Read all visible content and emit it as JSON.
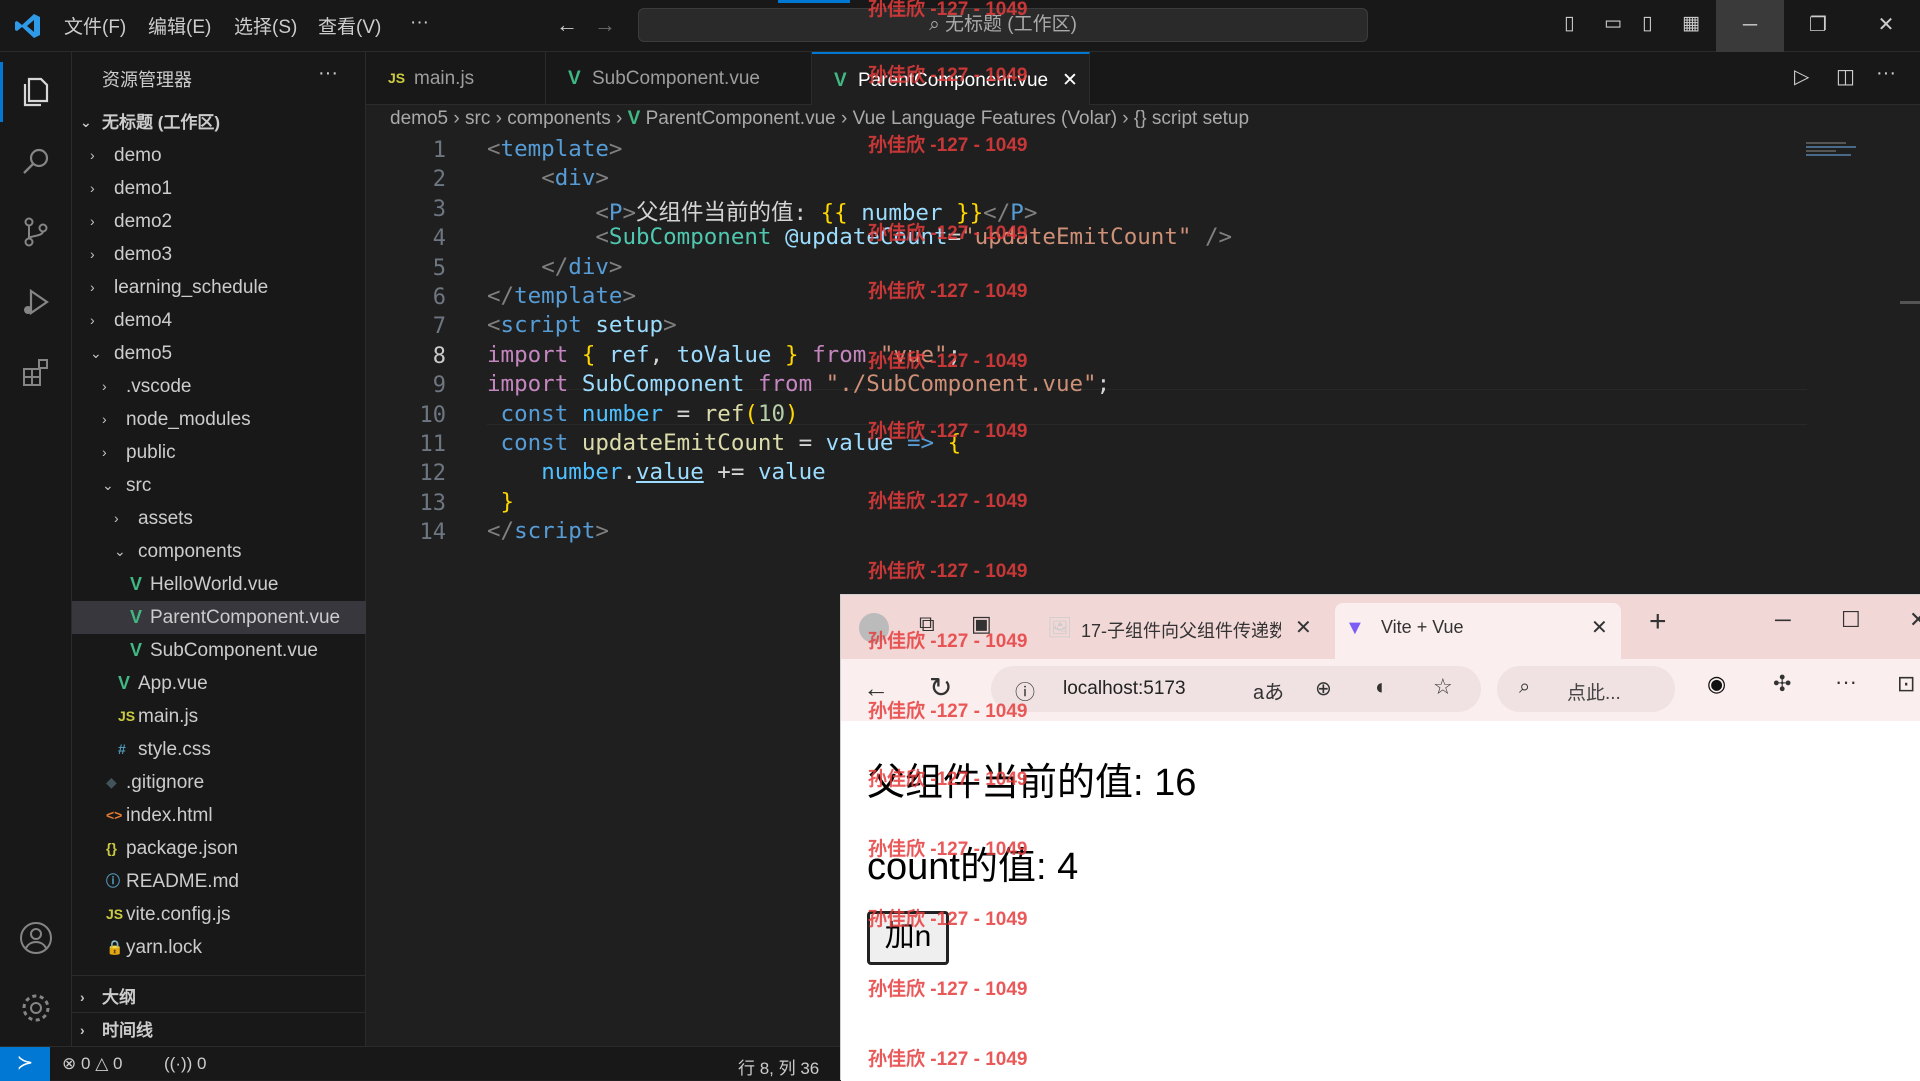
{
  "titlebar": {
    "menu": [
      "文件(F)",
      "编辑(E)",
      "选择(S)",
      "查看(V)",
      "···"
    ],
    "search_text": "无标题 (工作区)"
  },
  "sidebar": {
    "title": "资源管理器",
    "more": "···",
    "workspace": "无标题 (工作区)",
    "items": [
      {
        "label": "demo",
        "chev": "›"
      },
      {
        "label": "demo1",
        "chev": "›"
      },
      {
        "label": "demo2",
        "chev": "›"
      },
      {
        "label": "demo3",
        "chev": "›"
      },
      {
        "label": "learning_schedule",
        "chev": "›"
      },
      {
        "label": "demo4",
        "chev": "›"
      },
      {
        "label": "demo5",
        "chev": "⌄"
      },
      {
        "label": ".vscode",
        "chev": "›"
      },
      {
        "label": "node_modules",
        "chev": "›"
      },
      {
        "label": "public",
        "chev": "›"
      },
      {
        "label": "src",
        "chev": "⌄"
      },
      {
        "label": "assets",
        "chev": "›"
      },
      {
        "label": "components",
        "chev": "⌄"
      },
      {
        "label": "HelloWorld.vue",
        "icon": "V"
      },
      {
        "label": "ParentComponent.vue",
        "icon": "V"
      },
      {
        "label": "SubComponent.vue",
        "icon": "V"
      },
      {
        "label": "App.vue",
        "icon": "V"
      },
      {
        "label": "main.js",
        "icon": "JS"
      },
      {
        "label": "style.css",
        "icon": "#"
      },
      {
        "label": ".gitignore",
        "icon": "◆"
      },
      {
        "label": "index.html",
        "icon": "<>"
      },
      {
        "label": "package.json",
        "icon": "{}"
      },
      {
        "label": "README.md",
        "icon": "ⓘ"
      },
      {
        "label": "vite.config.js",
        "icon": "JS"
      },
      {
        "label": "yarn.lock",
        "icon": "🔒"
      }
    ],
    "outline": "大纲",
    "timeline": "时间线"
  },
  "tabs": [
    {
      "label": "main.js",
      "icon": "JS"
    },
    {
      "label": "SubComponent.vue",
      "icon": "V"
    },
    {
      "label": "ParentComponent.vue",
      "icon": "V",
      "close": "✕"
    }
  ],
  "breadcrumb": [
    "demo5",
    "src",
    "components",
    "ParentComponent.vue",
    "Vue Language Features (Volar)",
    "{} script setup"
  ],
  "editor": {
    "line_numbers": [
      "1",
      "2",
      "3",
      "4",
      "5",
      "6",
      "7",
      "8",
      "9",
      "10",
      "11",
      "12",
      "13",
      "14"
    ],
    "lines": [
      [
        {
          "c": "tg",
          "t": "<"
        },
        {
          "c": "tn",
          "t": "template"
        },
        {
          "c": "tg",
          "t": ">"
        }
      ],
      [
        {
          "c": "pl",
          "t": "    "
        },
        {
          "c": "tg",
          "t": "<"
        },
        {
          "c": "tn",
          "t": "div"
        },
        {
          "c": "tg",
          "t": ">"
        }
      ],
      [
        {
          "c": "pl",
          "t": "        "
        },
        {
          "c": "tg",
          "t": "<"
        },
        {
          "c": "tn",
          "t": "P"
        },
        {
          "c": "tg",
          "t": ">"
        },
        {
          "c": "pl",
          "t": "父组件当前的值: "
        },
        {
          "c": "br",
          "t": "{{"
        },
        {
          "c": "at",
          "t": " number "
        },
        {
          "c": "br",
          "t": "}}"
        },
        {
          "c": "tg",
          "t": "</"
        },
        {
          "c": "tn",
          "t": "P"
        },
        {
          "c": "tg",
          "t": ">"
        }
      ],
      [
        {
          "c": "pl",
          "t": "        "
        },
        {
          "c": "tg",
          "t": "<"
        },
        {
          "c": "cp",
          "t": "SubComponent"
        },
        {
          "c": "pl",
          "t": " "
        },
        {
          "c": "at",
          "t": "@updateCount"
        },
        {
          "c": "pl",
          "t": "="
        },
        {
          "c": "st",
          "t": "\"updateEmitCount\""
        },
        {
          "c": "pl",
          "t": " "
        },
        {
          "c": "tg",
          "t": "/>"
        }
      ],
      [
        {
          "c": "pl",
          "t": "    "
        },
        {
          "c": "tg",
          "t": "</"
        },
        {
          "c": "tn",
          "t": "div"
        },
        {
          "c": "tg",
          "t": ">"
        }
      ],
      [
        {
          "c": "tg",
          "t": "</"
        },
        {
          "c": "tn",
          "t": "template"
        },
        {
          "c": "tg",
          "t": ">"
        }
      ],
      [
        {
          "c": "tg",
          "t": "<"
        },
        {
          "c": "tn",
          "t": "script"
        },
        {
          "c": "pl",
          "t": " "
        },
        {
          "c": "at",
          "t": "setup"
        },
        {
          "c": "tg",
          "t": ">"
        }
      ],
      [
        {
          "c": "kw",
          "t": "import"
        },
        {
          "c": "pl",
          "t": " "
        },
        {
          "c": "br",
          "t": "{"
        },
        {
          "c": "at",
          "t": " ref"
        },
        {
          "c": "pl",
          "t": ", "
        },
        {
          "c": "at",
          "t": "toValue "
        },
        {
          "c": "br",
          "t": "}"
        },
        {
          "c": "pl",
          "t": " "
        },
        {
          "c": "kw",
          "t": "from"
        },
        {
          "c": "pl",
          "t": " "
        },
        {
          "c": "st",
          "t": "\"vue\""
        },
        {
          "c": "pl",
          "t": ";"
        }
      ],
      [
        {
          "c": "kw",
          "t": "import"
        },
        {
          "c": "pl",
          "t": " "
        },
        {
          "c": "at",
          "t": "SubComponent"
        },
        {
          "c": "pl",
          "t": " "
        },
        {
          "c": "kw",
          "t": "from"
        },
        {
          "c": "pl",
          "t": " "
        },
        {
          "c": "st",
          "t": "\"./SubComponent.vue\""
        },
        {
          "c": "pl",
          "t": ";"
        }
      ],
      [
        {
          "c": "pl",
          "t": " "
        },
        {
          "c": "tn",
          "t": "const"
        },
        {
          "c": "pl",
          "t": " "
        },
        {
          "c": "vr",
          "t": "number"
        },
        {
          "c": "pl",
          "t": " = "
        },
        {
          "c": "fn",
          "t": "ref"
        },
        {
          "c": "br",
          "t": "("
        },
        {
          "c": "nm",
          "t": "10"
        },
        {
          "c": "br",
          "t": ")"
        }
      ],
      [
        {
          "c": "pl",
          "t": " "
        },
        {
          "c": "tn",
          "t": "const"
        },
        {
          "c": "pl",
          "t": " "
        },
        {
          "c": "fn",
          "t": "updateEmitCount"
        },
        {
          "c": "pl",
          "t": " = "
        },
        {
          "c": "at",
          "t": "value"
        },
        {
          "c": "pl",
          "t": " "
        },
        {
          "c": "tn",
          "t": "=>"
        },
        {
          "c": "pl",
          "t": " "
        },
        {
          "c": "br",
          "t": "{"
        }
      ],
      [
        {
          "c": "pl",
          "t": "    "
        },
        {
          "c": "vr",
          "t": "number"
        },
        {
          "c": "pl",
          "t": "."
        },
        {
          "c": "at",
          "t": "value"
        },
        {
          "c": "pl",
          "t": " += "
        },
        {
          "c": "at",
          "t": "value"
        }
      ],
      [
        {
          "c": "pl",
          "t": " "
        },
        {
          "c": "br",
          "t": "}"
        }
      ],
      [
        {
          "c": "tg",
          "t": "</"
        },
        {
          "c": "tn",
          "t": "script"
        },
        {
          "c": "tg",
          "t": ">"
        }
      ]
    ]
  },
  "statusbar": {
    "remote": "≻",
    "errors": "0",
    "warnings": "0",
    "ports": "0",
    "cursor": "行 8, 列 36"
  },
  "browser": {
    "tab1": "17-子组件向父组件传递数",
    "tab2": "Vite + Vue",
    "new_tab": "+",
    "url": "localhost:5173",
    "search_placeholder": "点此...",
    "content": {
      "parent_value": "父组件当前的值: 16",
      "count_value": "count的值: 4",
      "add_button": "加n"
    }
  },
  "watermark": "孙佳欣 -127 - 1049",
  "colors": {
    "accent": "#0078d4",
    "vue_green": "#41b883",
    "js_yellow": "#cbcb41"
  }
}
